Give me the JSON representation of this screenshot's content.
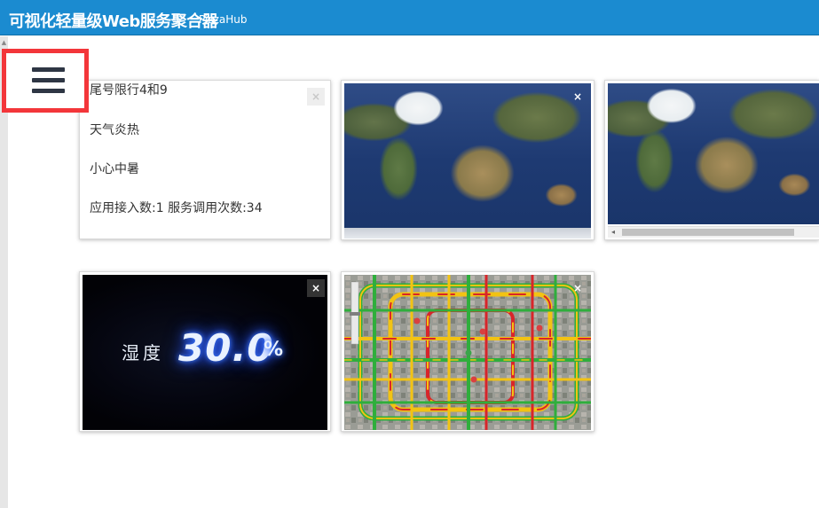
{
  "header": {
    "title": "可视化轻量级Web服务聚合器",
    "subtitle": "PizzaHub"
  },
  "menu": {
    "icon": "hamburger-menu-icon"
  },
  "text_card": {
    "lines": [
      "尾号限行4和9",
      "天气炎热",
      "小心中暑",
      "应用接入数:1 服务调用次数:34"
    ],
    "close": "×"
  },
  "map_card_1": {
    "close": "×"
  },
  "map_card_2": {
    "scroll_left": "◂"
  },
  "humidity_card": {
    "label": "湿度",
    "value": "30.0",
    "unit": "%",
    "close": "×"
  },
  "traffic_card": {
    "close": "×"
  },
  "colors": {
    "header": "#1b8bd0",
    "menu_highlight": "#f3363a",
    "traffic_congested": "#d8252a",
    "traffic_slow": "#f2c313",
    "traffic_free": "#2fae3c"
  }
}
